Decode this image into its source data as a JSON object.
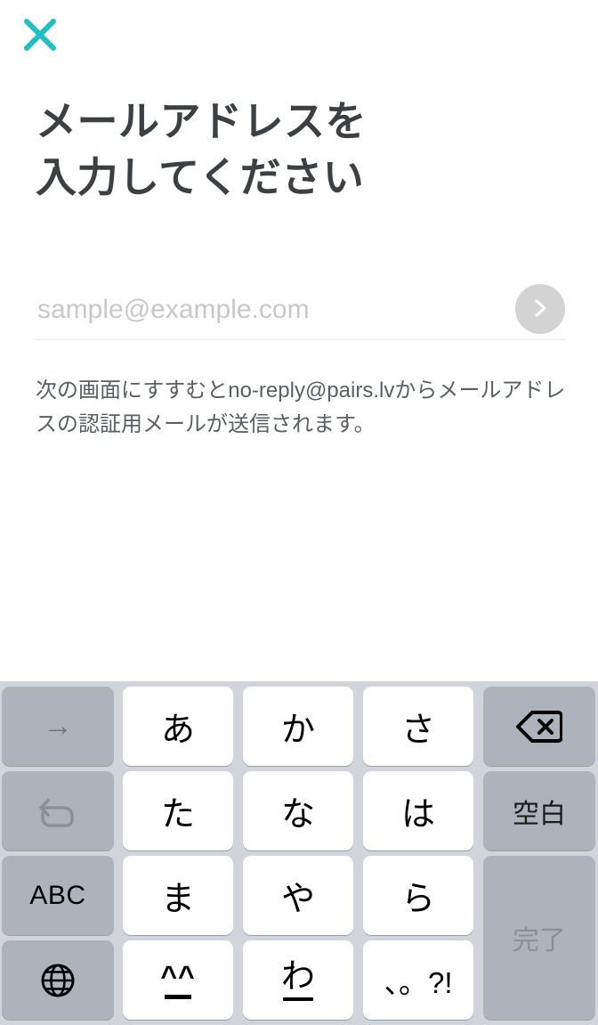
{
  "app": {
    "background_color": "#ffffff",
    "accent_color": "#22c0c4"
  },
  "header": {
    "close_icon": "close-icon",
    "close_label": "閉じる"
  },
  "main": {
    "heading": "メールアドレスを\n入力してください",
    "email_field": {
      "value": "",
      "placeholder": "sample@example.com",
      "placeholder_color": "#c8c8c8"
    },
    "submit_button": {
      "icon": "chevron-right-icon",
      "background_color": "#d3d3d3"
    },
    "description": "次の画面にすすむとno-reply@pairs.lvからメールアドレスの認証用メールが送信されます。"
  },
  "keyboard": {
    "type": "ios-japanese-kana",
    "background_color": "#d1d5db",
    "key_white": "#ffffff",
    "key_gray": "#adb3bd",
    "keys": {
      "next_candidate": "→",
      "undo": "undo-arrow-icon",
      "abc": "ABC",
      "globe": "globe-icon",
      "a": "あ",
      "ka": "か",
      "sa": "さ",
      "ta": "た",
      "na": "な",
      "ha": "は",
      "ma": "ま",
      "ya": "や",
      "ra": "ら",
      "emoticon": "^_^",
      "wa": "わ",
      "wa_under": "_",
      "punctuation": "、。?!",
      "backspace": "delete-left-icon",
      "space": "空白",
      "done": "完了"
    }
  }
}
